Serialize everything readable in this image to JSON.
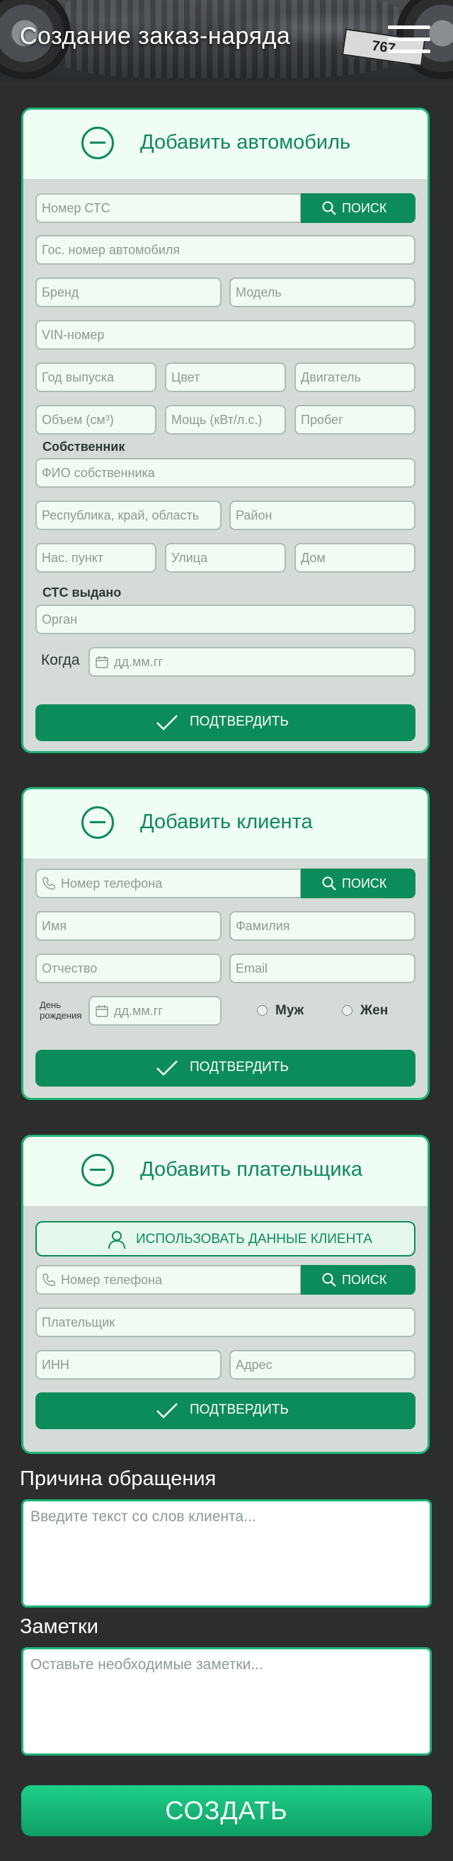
{
  "header": {
    "title": "Создание заказ-наряда",
    "plate_text": "767"
  },
  "colors": {
    "accent": "#0d8c5b",
    "accent_border": "#21b47a",
    "card_bg": "#d5dcd7",
    "page_bg": "#2b2e2d"
  },
  "vehicle": {
    "title": "Добавить автомобиль",
    "sts_number_placeholder": "Номер СТС",
    "search_label": "ПОИСК",
    "plate_placeholder": "Гос. номер автомобиля",
    "brand_placeholder": "Бренд",
    "model_placeholder": "Модель",
    "vin_placeholder": "VIN-номер",
    "year_placeholder": "Год выпуска",
    "color_placeholder": "Цвет",
    "engine_placeholder": "Двигатель",
    "volume_placeholder": "Объем (см³)",
    "power_placeholder": "Мощь (кВт/л.с.)",
    "mileage_placeholder": "Пробег",
    "owner_label": "Собственник",
    "owner_name_placeholder": "ФИО собственника",
    "region_placeholder": "Республика, край, область",
    "district_placeholder": "Район",
    "locality_placeholder": "Нас. пункт",
    "street_placeholder": "Улица",
    "house_placeholder": "Дом",
    "sts_issued_label": "СТС выдано",
    "authority_placeholder": "Орган",
    "when_label": "Когда",
    "date_placeholder": "дд.мм.гг",
    "confirm_label": "ПОДТВЕРДИТЬ"
  },
  "client": {
    "title": "Добавить клиента",
    "phone_placeholder": "Номер телефона",
    "search_label": "ПОИСК",
    "first_name_placeholder": "Имя",
    "last_name_placeholder": "Фамилия",
    "patronymic_placeholder": "Отчество",
    "email_placeholder": "Email",
    "birthday_label_line1": "День",
    "birthday_label_line2": "рождения",
    "date_placeholder": "дд.мм.гг",
    "gender_male": "Муж",
    "gender_female": "Жен",
    "confirm_label": "ПОДТВЕРДИТЬ"
  },
  "payer": {
    "title": "Добавить плательщика",
    "use_client_label": "ИСПОЛЬЗОВАТЬ ДАННЫЕ КЛИЕНТА",
    "phone_placeholder": "Номер телефона",
    "search_label": "ПОИСК",
    "payer_placeholder": "Плательщик",
    "inn_placeholder": "ИНН",
    "address_placeholder": "Адрес",
    "confirm_label": "ПОДТВЕРДИТЬ"
  },
  "reason": {
    "title": "Причина обращения",
    "placeholder": "Введите текст со слов клиента..."
  },
  "notes": {
    "title": "Заметки",
    "placeholder": "Оставьте необходимые заметки..."
  },
  "create_label": "СОЗДАТЬ"
}
